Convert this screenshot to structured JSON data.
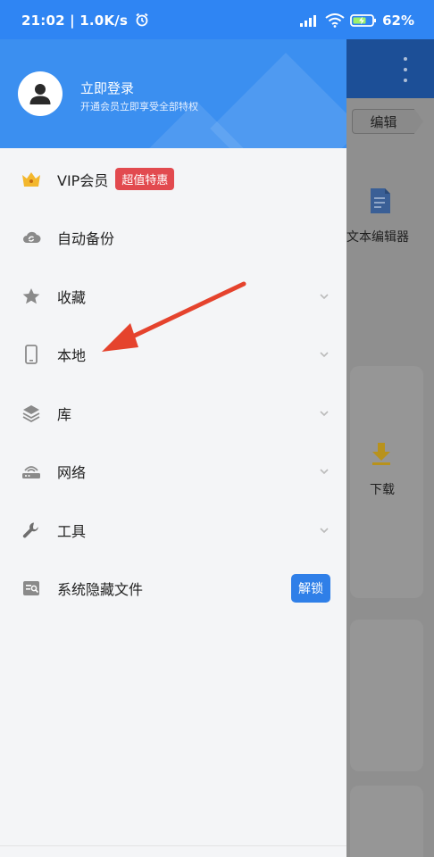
{
  "status_bar": {
    "time": "21:02 | 1.0K/s",
    "battery": "62%"
  },
  "background_app": {
    "edit_label": "编辑",
    "text_editor_label": "文本编辑器",
    "download_label": "下载"
  },
  "drawer": {
    "login": {
      "title": "立即登录",
      "subtitle": "开通会员立即享受全部特权"
    },
    "items": [
      {
        "label": "VIP会员",
        "icon": "crown-icon",
        "badge": "超值特惠"
      },
      {
        "label": "自动备份",
        "icon": "cloud-sync-icon"
      },
      {
        "label": "收藏",
        "icon": "star-icon",
        "expandable": true
      },
      {
        "label": "本地",
        "icon": "phone-icon",
        "expandable": true
      },
      {
        "label": "库",
        "icon": "layers-icon",
        "expandable": true
      },
      {
        "label": "网络",
        "icon": "network-router-icon",
        "expandable": true
      },
      {
        "label": "工具",
        "icon": "wrench-icon",
        "expandable": true
      },
      {
        "label": "系统隐藏文件",
        "icon": "hidden-file-icon",
        "action": "解锁"
      }
    ]
  },
  "colors": {
    "status_bar": "#2f85f3",
    "drawer_header": "#3b8ff0",
    "promo_badge": "#e24a4f",
    "unlock_button": "#2f7fe8",
    "arrow": "#e5432d"
  }
}
